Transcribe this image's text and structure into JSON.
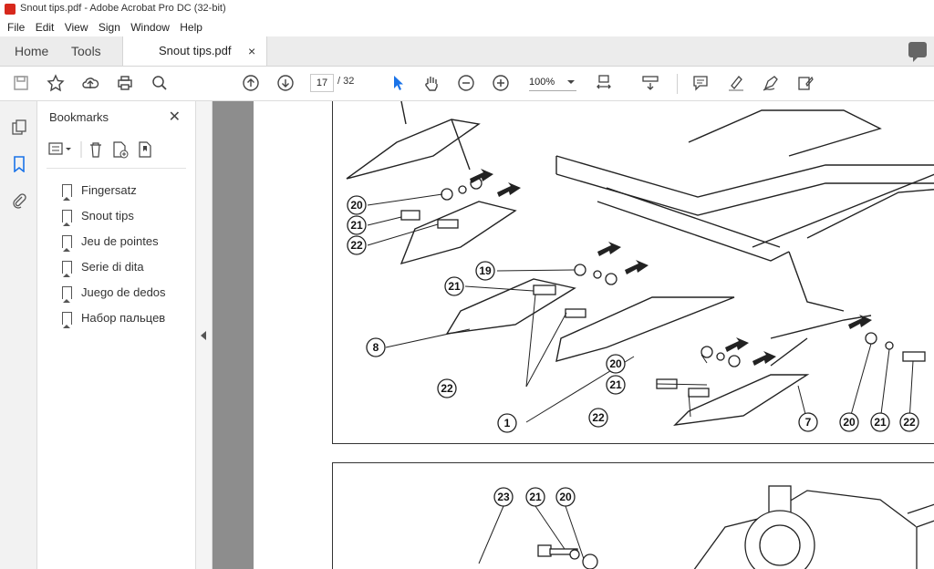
{
  "window": {
    "title": "Snout tips.pdf - Adobe Acrobat Pro DC (32-bit)"
  },
  "menu": [
    "File",
    "Edit",
    "View",
    "Sign",
    "Window",
    "Help"
  ],
  "tabs": {
    "home": "Home",
    "tools": "Tools",
    "document": "Snout tips.pdf",
    "close": "×"
  },
  "toolbar": {
    "page_current": "17",
    "page_total": "/ 32",
    "zoom": "100%"
  },
  "bookmarks": {
    "title": "Bookmarks",
    "close": "✕",
    "items": [
      "Fingersatz",
      "Snout tips",
      "Jeu de pointes",
      "Serie di dita",
      "Juego de dedos",
      "Набор пальцев"
    ]
  },
  "diagram": {
    "callouts_top": [
      "20",
      "21",
      "22",
      "19",
      "21",
      "8",
      "22",
      "1",
      "20",
      "21",
      "22",
      "7",
      "20",
      "21",
      "22"
    ],
    "callouts_bottom": [
      "23",
      "21",
      "20"
    ]
  }
}
